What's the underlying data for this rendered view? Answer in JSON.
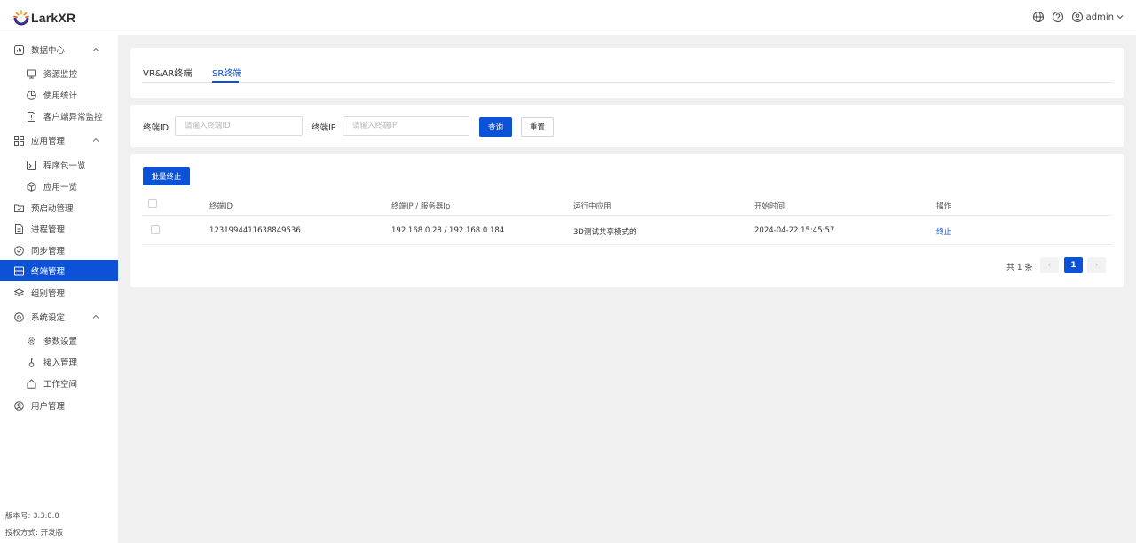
{
  "app": {
    "logo_text": "LarkXR"
  },
  "header": {
    "user_name": "admin"
  },
  "sidebar": {
    "items": [
      {
        "label": "数据中心"
      },
      {
        "label": "资源监控"
      },
      {
        "label": "使用统计"
      },
      {
        "label": "客户端异常监控"
      },
      {
        "label": "应用管理"
      },
      {
        "label": "程序包一览"
      },
      {
        "label": "应用一览"
      },
      {
        "label": "预启动管理"
      },
      {
        "label": "进程管理"
      },
      {
        "label": "同步管理"
      },
      {
        "label": "终端管理"
      },
      {
        "label": "组别管理"
      },
      {
        "label": "系统设定"
      },
      {
        "label": "参数设置"
      },
      {
        "label": "接入管理"
      },
      {
        "label": "工作空间"
      },
      {
        "label": "用户管理"
      }
    ],
    "version": "版本号: 3.3.0.0",
    "license": "授权方式: 开发版"
  },
  "tabs": [
    {
      "label": "VR&AR终端"
    },
    {
      "label": "SR终端"
    }
  ],
  "filter": {
    "terminal_id_label": "终端ID",
    "terminal_id_placeholder": "请输入终端ID",
    "terminal_ip_label": "终端IP",
    "terminal_ip_placeholder": "请输入终端IP",
    "query_label": "查询",
    "reset_label": "重置"
  },
  "table": {
    "batch_stop_label": "批量终止",
    "columns": [
      "终端ID",
      "终端IP / 服务器Ip",
      "运行中应用",
      "开始时间",
      "操作"
    ],
    "rows": [
      {
        "terminal_id": "1231994411638849536",
        "ips": "192.168.0.28 / 192.168.0.184",
        "app": "3D测试共享模式的",
        "start_time": "2024-04-22 15:45:57",
        "action": "终止"
      }
    ]
  },
  "pagination": {
    "total_text": "共 1 条",
    "current_page": "1",
    "prev": "‹",
    "next": "›"
  },
  "colors": {
    "accent": "#0b52d8"
  }
}
